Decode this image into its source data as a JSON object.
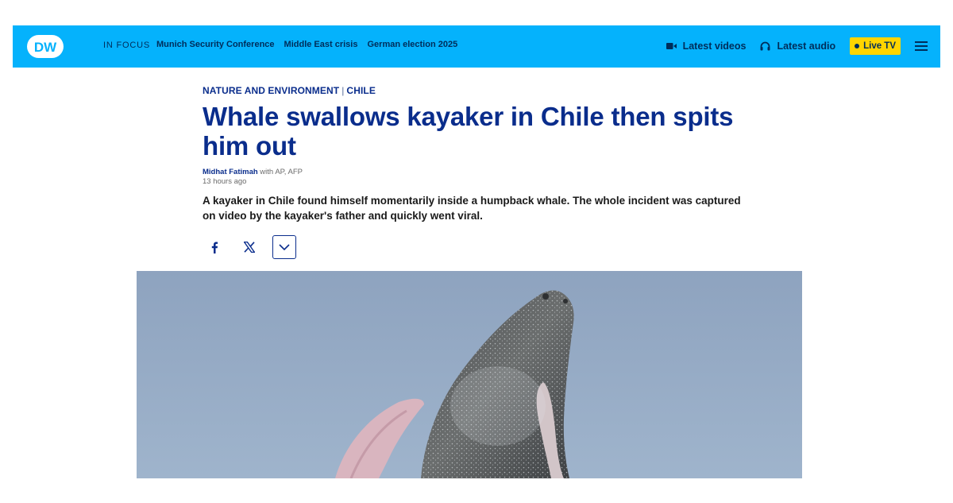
{
  "brand": {
    "logo_text": "DW"
  },
  "nav": {
    "in_focus_label": "IN FOCUS",
    "links": [
      "Munich Security Conference",
      "Middle East crisis",
      "German election 2025"
    ],
    "latest_videos": "Latest videos",
    "latest_audio": "Latest audio",
    "live_tv": "Live TV"
  },
  "article": {
    "category_primary": "NATURE AND ENVIRONMENT",
    "category_separator": "|",
    "category_secondary": "CHILE",
    "headline": "Whale swallows kayaker in Chile then spits him out",
    "author": "Midhat Fatimah",
    "byline_suffix": " with AP, AFP",
    "timestamp": "13 hours ago",
    "teaser": "A kayaker in Chile found himself momentarily inside a humpback whale. The whole incident was captured on video by the kayaker's father and quickly went viral."
  },
  "icons": {
    "logo": "dw-logo",
    "video": "video-camera-icon",
    "audio": "headphones-icon",
    "menu": "hamburger-menu-icon",
    "facebook": "facebook-icon",
    "x": "x-icon",
    "more": "chevron-down-icon"
  },
  "colors": {
    "topbar": "#05b2fc",
    "nav_text": "#002d5a",
    "headline": "#0a2d8c",
    "live_badge": "#ffd500"
  }
}
